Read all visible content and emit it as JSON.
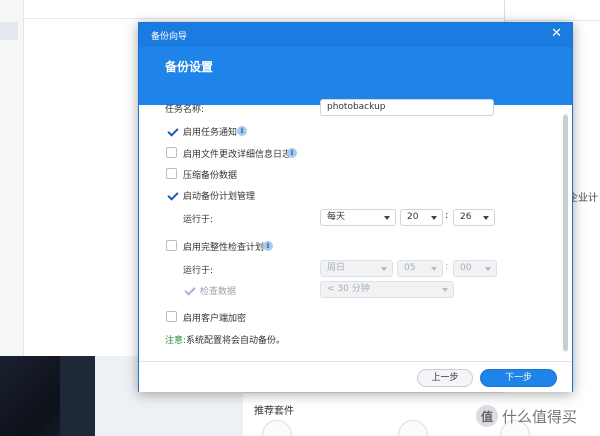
{
  "background": {
    "right_panel_text": "企业计",
    "store_title": "推荐套件",
    "watermark": "什么值得买",
    "watermark_logo": "值"
  },
  "dialog": {
    "title": "备份向导",
    "close_symbol": "✕",
    "heading": "备份设置",
    "task_name": {
      "label": "任务名称:",
      "value": "photobackup"
    },
    "enable_task_notification": {
      "label": "启用任务通知",
      "checked": true
    },
    "enable_file_change_log": {
      "label": "启用文件更改详细信息日志",
      "checked": false
    },
    "compress_backup_data": {
      "label": "压缩备份数据",
      "checked": false
    },
    "enable_backup_schedule": {
      "label": "启动备份计划管理",
      "checked": true,
      "run_label": "运行于:",
      "frequency": "每天",
      "hour": "20",
      "minute": "26",
      "separator": ":"
    },
    "enable_integrity_check": {
      "label": "启用完整性检查计划",
      "checked": false,
      "run_label": "运行于:",
      "day": "周日",
      "hour": "05",
      "minute": "00",
      "separator": ":",
      "check_data_label": "检查数据",
      "check_data_checked": true,
      "duration": "< 30 分钟"
    },
    "enable_client_encryption": {
      "label": "启用客户端加密",
      "checked": false
    },
    "notice": {
      "key": "注意:",
      "text": "系统配置将会自动备份。"
    },
    "buttons": {
      "prev": "上一步",
      "next": "下一步"
    },
    "info_icon_glyph": "i"
  },
  "colors": {
    "titlebar": "#1a7be0",
    "header": "#1e84e9",
    "primary_button": "#1e84e9",
    "notice_key": "#2a8a3e",
    "checkmark": "#1f5fa8"
  }
}
